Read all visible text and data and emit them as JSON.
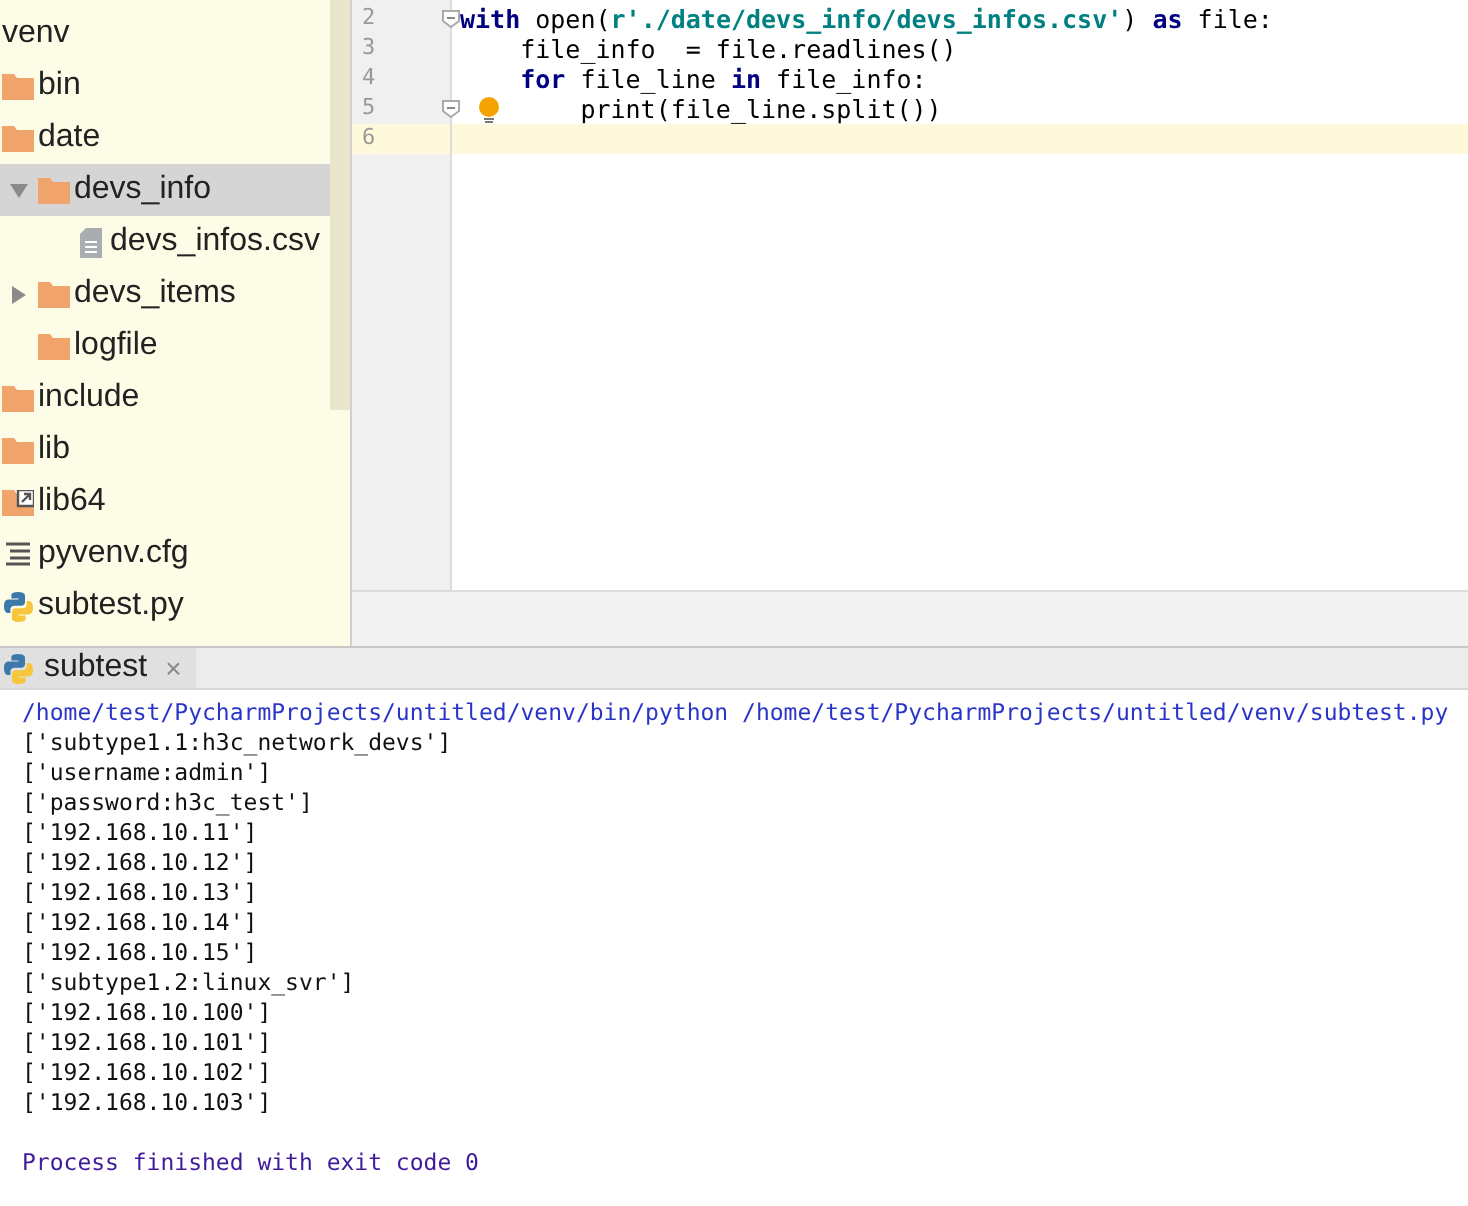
{
  "project_tree": [
    {
      "label": "venv",
      "children": [
        {
          "label": "bin",
          "kind": "folder"
        },
        {
          "label": "date",
          "kind": "folder",
          "children": [
            {
              "label": "devs_info",
              "kind": "folder",
              "expanded": true,
              "selected": true,
              "children": [
                {
                  "label": "devs_infos.csv",
                  "kind": "file",
                  "selected": false
                }
              ]
            },
            {
              "label": "devs_items",
              "kind": "folder",
              "expanded": false,
              "selected": false
            },
            {
              "label": "logfile",
              "kind": "folder",
              "selected": false
            }
          ]
        },
        {
          "label": "include",
          "kind": "folder"
        },
        {
          "label": "lib",
          "kind": "folder"
        },
        {
          "label": "lib64",
          "kind": "folder-link"
        },
        {
          "label": "pyvenv.cfg",
          "kind": "config"
        },
        {
          "label": "subtest.py",
          "kind": "python"
        }
      ]
    }
  ],
  "editor": {
    "lines": [
      {
        "number": "2",
        "fold": true,
        "tokens": [
          {
            "text": "with",
            "kind": "keyword"
          },
          {
            "text": " open(",
            "kind": "plain"
          },
          {
            "text": "r'./date/devs_info/devs_infos.csv'",
            "kind": "string"
          },
          {
            "text": ") ",
            "kind": "plain"
          },
          {
            "text": "as",
            "kind": "keyword"
          },
          {
            "text": " file:",
            "kind": "plain"
          }
        ],
        "children": [
          {
            "number": "3",
            "tokens": [
              {
                "text": "file_info  = file.readlines()",
                "kind": "plain"
              }
            ]
          },
          {
            "number": "4",
            "tokens": [
              {
                "text": "for",
                "kind": "keyword"
              },
              {
                "text": " file_line ",
                "kind": "plain"
              },
              {
                "text": "in",
                "kind": "keyword"
              },
              {
                "text": " file_info:",
                "kind": "plain"
              }
            ],
            "children": [
              {
                "number": "5",
                "fold": true,
                "bulb": true,
                "tokens": [
                  {
                    "text": "print(file_line.split())",
                    "kind": "plain"
                  }
                ]
              }
            ]
          }
        ]
      },
      {
        "number": "6",
        "current": true
      }
    ]
  },
  "run_tab": {
    "label": "subtest",
    "close": "×"
  },
  "console": [
    {
      "text": "/home/test/PycharmProjects/untitled/venv/bin/python /home/test/PycharmProjects/untitled/venv/subtest.py",
      "kind": "command"
    },
    {
      "text": "['subtype1.1:h3c_network_devs']",
      "kind": "output"
    },
    {
      "text": "['username:admin']",
      "kind": "output"
    },
    {
      "text": "['password:h3c_test']",
      "kind": "output"
    },
    {
      "text": "['192.168.10.11']",
      "kind": "output"
    },
    {
      "text": "['192.168.10.12']",
      "kind": "output"
    },
    {
      "text": "['192.168.10.13']",
      "kind": "output"
    },
    {
      "text": "['192.168.10.14']",
      "kind": "output"
    },
    {
      "text": "['192.168.10.15']",
      "kind": "output"
    },
    {
      "text": "['subtype1.2:linux_svr']",
      "kind": "output"
    },
    {
      "text": "['192.168.10.100']",
      "kind": "output"
    },
    {
      "text": "['192.168.10.101']",
      "kind": "output"
    },
    {
      "text": "['192.168.10.102']",
      "kind": "output"
    },
    {
      "text": "['192.168.10.103']",
      "kind": "output"
    },
    {
      "kind": "blank"
    },
    {
      "text": "Process finished with exit code 0",
      "kind": "status"
    }
  ]
}
